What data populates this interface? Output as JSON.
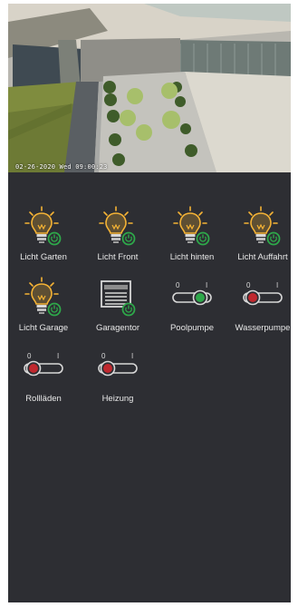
{
  "camera": {
    "timestamp": "02-26-2020 Wed 09:00:23"
  },
  "tiles": [
    {
      "label": "Licht Garten",
      "icon": "light-bulb-icon",
      "state": "on"
    },
    {
      "label": "Licht Front",
      "icon": "light-bulb-icon",
      "state": "on"
    },
    {
      "label": "Licht hinten",
      "icon": "light-bulb-icon",
      "state": "on"
    },
    {
      "label": "Licht Auffahrt",
      "icon": "light-bulb-icon",
      "state": "on"
    },
    {
      "label": "Licht Garage",
      "icon": "light-bulb-icon",
      "state": "on"
    },
    {
      "label": "Garagentor",
      "icon": "garage-door-icon",
      "state": "closed"
    },
    {
      "label": "Poolpumpe",
      "icon": "toggle-switch-icon",
      "state": "on",
      "switch_off": "0",
      "switch_on": "I"
    },
    {
      "label": "Wasserpumpe",
      "icon": "toggle-switch-icon",
      "state": "off",
      "switch_off": "0",
      "switch_on": "I"
    },
    {
      "label": "Rollläden",
      "icon": "toggle-switch-icon",
      "state": "off",
      "switch_off": "0",
      "switch_on": "I"
    },
    {
      "label": "Heizung",
      "icon": "toggle-switch-icon",
      "state": "off",
      "switch_off": "0",
      "switch_on": "I"
    }
  ],
  "colors": {
    "panel_bg": "#2d2e33",
    "bulb_glow": "#f5b335",
    "power_green": "#2ea84a",
    "switch_off_red": "#c0282e",
    "label_text": "#e8e8e8"
  }
}
